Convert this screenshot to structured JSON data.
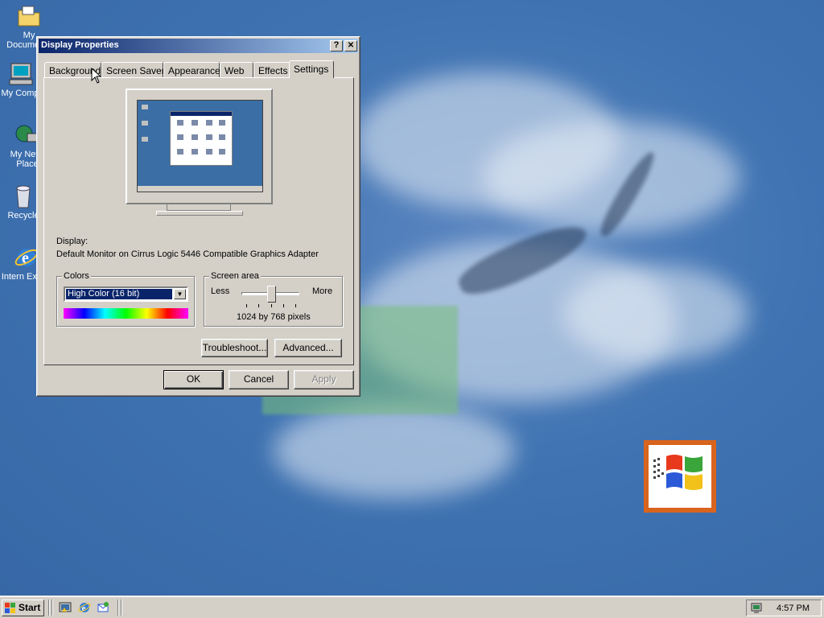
{
  "desktop": {
    "icons": [
      {
        "label": "My Documents",
        "icon": "folder-icon"
      },
      {
        "label": "My Comp",
        "icon": "computer-icon"
      },
      {
        "label": "My Netw Place",
        "icon": "network-icon"
      },
      {
        "label": "Recycle",
        "icon": "recycle-bin-icon"
      },
      {
        "label": "Intern Explor",
        "icon": "ie-icon"
      }
    ]
  },
  "dialog": {
    "title": "Display Properties",
    "help_button": "?",
    "close_button": "✕",
    "tabs": [
      "Background",
      "Screen Saver",
      "Appearance",
      "Web",
      "Effects",
      "Settings"
    ],
    "active_tab": "Settings",
    "display_label": "Display:",
    "display_value": "Default Monitor on Cirrus Logic 5446 Compatible Graphics Adapter",
    "colors": {
      "legend": "Colors",
      "selected": "High Color (16 bit)"
    },
    "screen_area": {
      "legend": "Screen area",
      "less": "Less",
      "more": "More",
      "value_text": "1024 by 768 pixels",
      "slider_position_index": 2,
      "slider_positions": 5
    },
    "buttons": {
      "troubleshoot": "Troubleshoot...",
      "advanced": "Advanced...",
      "ok": "OK",
      "cancel": "Cancel",
      "apply": "Apply"
    }
  },
  "taskbar": {
    "start": "Start",
    "quick_launch": [
      "show-desktop-icon",
      "ie-icon",
      "outlook-express-icon"
    ],
    "tray_icon": "display-settings-tray-icon",
    "clock": "4:57 PM"
  },
  "colors": {
    "desktop": "#3a6ea5",
    "title_bar": "#0a246a",
    "window_face": "#d4d0c8",
    "logo_frame": "#d9641e"
  }
}
